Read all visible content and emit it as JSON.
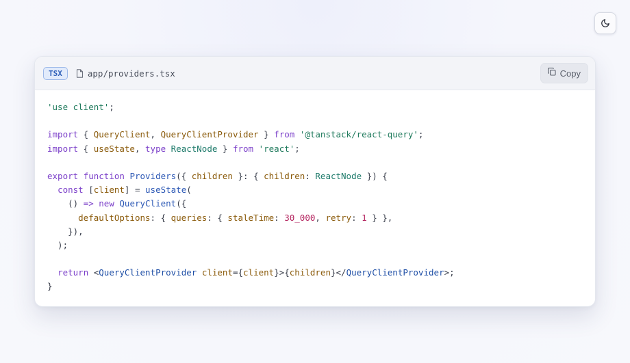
{
  "header": {
    "language": "TSX",
    "file_path": "app/providers.tsx",
    "copy_label": "Copy"
  },
  "theme_toggle": {
    "icon": "moon-icon"
  },
  "code_lines": [
    [
      [
        "str",
        "'use client'"
      ],
      [
        "p",
        ";"
      ]
    ],
    [],
    [
      [
        "kw",
        "import"
      ],
      [
        "p",
        " { "
      ],
      [
        "id",
        "QueryClient"
      ],
      [
        "p",
        ", "
      ],
      [
        "id",
        "QueryClientProvider"
      ],
      [
        "p",
        " } "
      ],
      [
        "kw",
        "from"
      ],
      [
        "p",
        " "
      ],
      [
        "str",
        "'@tanstack/react-query'"
      ],
      [
        "p",
        ";"
      ]
    ],
    [
      [
        "kw",
        "import"
      ],
      [
        "p",
        " { "
      ],
      [
        "id",
        "useState"
      ],
      [
        "p",
        ", "
      ],
      [
        "kw",
        "type"
      ],
      [
        "p",
        " "
      ],
      [
        "type",
        "ReactNode"
      ],
      [
        "p",
        " } "
      ],
      [
        "kw",
        "from"
      ],
      [
        "p",
        " "
      ],
      [
        "str",
        "'react'"
      ],
      [
        "p",
        ";"
      ]
    ],
    [],
    [
      [
        "kw",
        "export"
      ],
      [
        "p",
        " "
      ],
      [
        "kw",
        "function"
      ],
      [
        "p",
        " "
      ],
      [
        "fn",
        "Providers"
      ],
      [
        "p",
        "({ "
      ],
      [
        "id",
        "children"
      ],
      [
        "p",
        " }: { "
      ],
      [
        "id",
        "children"
      ],
      [
        "p",
        ": "
      ],
      [
        "type",
        "ReactNode"
      ],
      [
        "p",
        " }) {"
      ]
    ],
    [
      [
        "p",
        "  "
      ],
      [
        "kw",
        "const"
      ],
      [
        "p",
        " ["
      ],
      [
        "id",
        "client"
      ],
      [
        "p",
        "] = "
      ],
      [
        "fn",
        "useState"
      ],
      [
        "p",
        "("
      ]
    ],
    [
      [
        "p",
        "    () "
      ],
      [
        "kw",
        "=>"
      ],
      [
        "p",
        " "
      ],
      [
        "kw",
        "new"
      ],
      [
        "p",
        " "
      ],
      [
        "fn",
        "QueryClient"
      ],
      [
        "p",
        "({"
      ]
    ],
    [
      [
        "p",
        "      "
      ],
      [
        "id",
        "defaultOptions"
      ],
      [
        "p",
        ": { "
      ],
      [
        "id",
        "queries"
      ],
      [
        "p",
        ": { "
      ],
      [
        "id",
        "staleTime"
      ],
      [
        "p",
        ": "
      ],
      [
        "num",
        "30_000"
      ],
      [
        "p",
        ", "
      ],
      [
        "id",
        "retry"
      ],
      [
        "p",
        ": "
      ],
      [
        "num",
        "1"
      ],
      [
        "p",
        " } },"
      ]
    ],
    [
      [
        "p",
        "    }),"
      ]
    ],
    [
      [
        "p",
        "  );"
      ]
    ],
    [],
    [
      [
        "p",
        "  "
      ],
      [
        "kw",
        "return"
      ],
      [
        "p",
        " <"
      ],
      [
        "tag",
        "QueryClientProvider"
      ],
      [
        "p",
        " "
      ],
      [
        "attr",
        "client"
      ],
      [
        "p",
        "={"
      ],
      [
        "id",
        "client"
      ],
      [
        "p",
        "}>{"
      ],
      [
        "id",
        "children"
      ],
      [
        "p",
        "}</"
      ],
      [
        "tag",
        "QueryClientProvider"
      ],
      [
        "p",
        ">;"
      ]
    ],
    [
      [
        "p",
        "}"
      ]
    ]
  ]
}
